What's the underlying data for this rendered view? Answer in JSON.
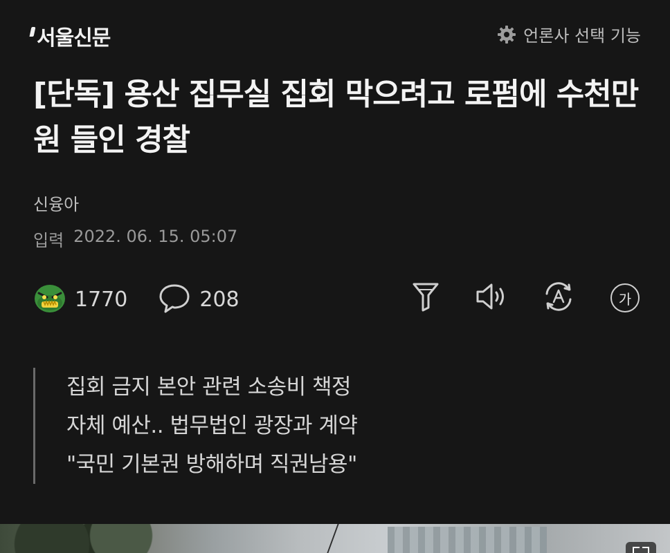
{
  "header": {
    "logo": "서울신문",
    "press_select_label": "언론사 선택 기능",
    "press_select_icon": "gear-icon"
  },
  "article": {
    "title": "[단독] 용산 집무실 집회 막으려고 로펌에 수천만원 들인 경찰",
    "author": "신융아",
    "date_label": "입력",
    "date_value": "2022. 06. 15. 05:07"
  },
  "actions": {
    "reaction_icon": "angry-face-icon",
    "reaction_count": "1770",
    "comment_icon": "speech-bubble-icon",
    "comment_count": "208",
    "right_icons": [
      "summary-filter-icon",
      "speaker-icon",
      "translate-icon",
      "font-size-icon"
    ],
    "font_size_glyph": "가"
  },
  "summary": {
    "lines": [
      "집회 금지 본안 관련 소송비 책정",
      "자체 예산.. 법무법인 광장과 계약",
      "\"국민 기본권 방해하며 직권남용\""
    ]
  },
  "colors": {
    "background": "#161616",
    "text_primary": "#f3f3f3",
    "text_secondary": "#bdbdbd",
    "accent_green": "#3a8f3a"
  }
}
